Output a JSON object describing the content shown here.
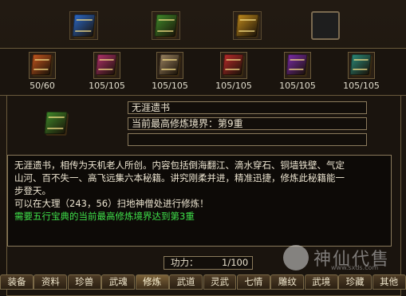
{
  "top_row": {
    "slots": [
      {
        "icon": "book-icon-blue",
        "color": "#2a68c8"
      },
      {
        "icon": "book-icon-green",
        "color": "#3f8a2a"
      },
      {
        "icon": "book-icon-gold",
        "color": "#c08a1c"
      },
      {
        "icon": "empty-slot-icon",
        "color": "#222222"
      }
    ]
  },
  "inventory": {
    "items": [
      {
        "icon": "book-icon-orange",
        "color": "#c4561e",
        "count": "50/60"
      },
      {
        "icon": "book-icon-pink",
        "color": "#b0306a",
        "count": "105/105"
      },
      {
        "icon": "book-icon-tan",
        "color": "#9a8260",
        "count": "105/105"
      },
      {
        "icon": "book-icon-red",
        "color": "#b82a2a",
        "count": "105/105"
      },
      {
        "icon": "book-icon-purple",
        "color": "#7a2aa8",
        "count": "105/105"
      },
      {
        "icon": "book-icon-teal",
        "color": "#2a8a7a",
        "count": "105/105"
      }
    ]
  },
  "selected": {
    "icon": "book-icon-green",
    "color": "#3f8a2a",
    "name": "无涯遗书",
    "realm": "当前最高修炼境界：第9重",
    "extra": ""
  },
  "description": {
    "lines": [
      "无涯遗书，相传为天机老人所创。内容包括倒海翻江、滴水穿石、铜墙铁壁、气定",
      "山河、百不失一、高飞远集六本秘籍。讲究刚柔并进，精准迅捷，修炼此秘籍能一",
      "步登天。",
      "可以在大理（243，56）扫地神僧处进行修炼！"
    ],
    "requirement": "需要五行宝典的当前最高修炼境界达到第3重"
  },
  "power": {
    "label": "功力：",
    "value": "1/100"
  },
  "tabs": [
    {
      "label": "装备"
    },
    {
      "label": "资料"
    },
    {
      "label": "珍兽"
    },
    {
      "label": "武魂"
    },
    {
      "label": "修炼",
      "active": true
    },
    {
      "label": "武道"
    },
    {
      "label": "灵武"
    },
    {
      "label": "七情"
    },
    {
      "label": "雕纹"
    },
    {
      "label": "武境"
    },
    {
      "label": "珍藏"
    },
    {
      "label": "其他"
    }
  ],
  "watermark": {
    "text": "神仙代售",
    "url": "www.sxds.com"
  }
}
